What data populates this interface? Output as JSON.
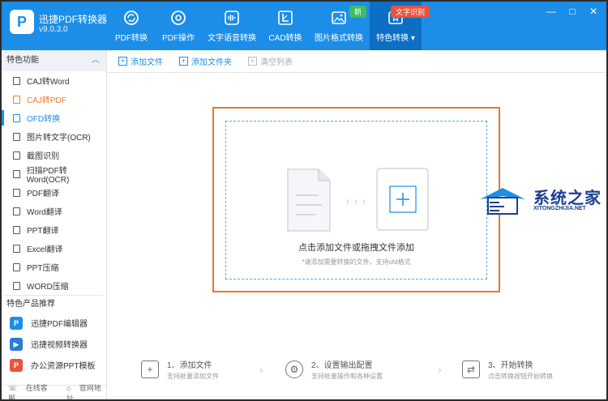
{
  "app": {
    "title": "迅捷PDF转换器",
    "version": "v9.0.3.0",
    "logo": "P"
  },
  "nav": [
    {
      "label": "PDF转换",
      "icon": "refresh-circle-icon"
    },
    {
      "label": "PDF操作",
      "icon": "target-icon"
    },
    {
      "label": "文字语音转换",
      "icon": "audio-wave-icon"
    },
    {
      "label": "CAD转换",
      "icon": "cad-icon"
    },
    {
      "label": "图片格式转换",
      "icon": "image-icon",
      "badge": "新"
    },
    {
      "label": "特色转换",
      "icon": "star-swap-icon",
      "badge": "文字识别",
      "active": true
    }
  ],
  "window_controls": [
    "—",
    "□",
    "✕"
  ],
  "sidebar": {
    "section_title": "特色功能",
    "items": [
      {
        "label": "CAJ转Word"
      },
      {
        "label": "CAJ转PDF",
        "state": "highlight"
      },
      {
        "label": "OFD转换",
        "state": "active"
      },
      {
        "label": "图片转文字(OCR)"
      },
      {
        "label": "截图识别"
      },
      {
        "label": "扫描PDF转Word(OCR)"
      },
      {
        "label": "PDF翻译"
      },
      {
        "label": "Word翻译"
      },
      {
        "label": "PPT翻译"
      },
      {
        "label": "Excel翻译"
      },
      {
        "label": "PPT压缩"
      },
      {
        "label": "WORD压缩"
      }
    ],
    "products_title": "特色产品推荐",
    "products": [
      {
        "label": "迅捷PDF编辑器",
        "color": "#1c8ee8",
        "glyph": "P"
      },
      {
        "label": "迅捷视频转换器",
        "color": "#2a7ad8",
        "glyph": "▶"
      },
      {
        "label": "办公资源PPT模板",
        "color": "#e8543c",
        "glyph": "P"
      }
    ],
    "bottom_links": [
      "在线客服",
      "官网地址"
    ]
  },
  "toolbar": {
    "add_file": "添加文件",
    "add_folder": "添加文件夹",
    "clear_list": "清空列表"
  },
  "dropzone": {
    "main_text": "点击添加文件或拖拽文件添加",
    "sub_text": "*请添加需要转换的文件，支持ofd格式"
  },
  "steps": [
    {
      "title": "1、添加文件",
      "desc": "支持批量添加文件"
    },
    {
      "title": "2、设置输出配置",
      "desc": "支持批量操作和各种设置"
    },
    {
      "title": "3、开始转换",
      "desc": "点击转换按钮开始转换"
    }
  ],
  "watermark": {
    "title": "系统之家",
    "sub": "XITONGZHIJIA.NET"
  },
  "colors": {
    "brand": "#1c8ee8",
    "highlight": "#e8782a",
    "active_nav": "#0d6fc4"
  }
}
